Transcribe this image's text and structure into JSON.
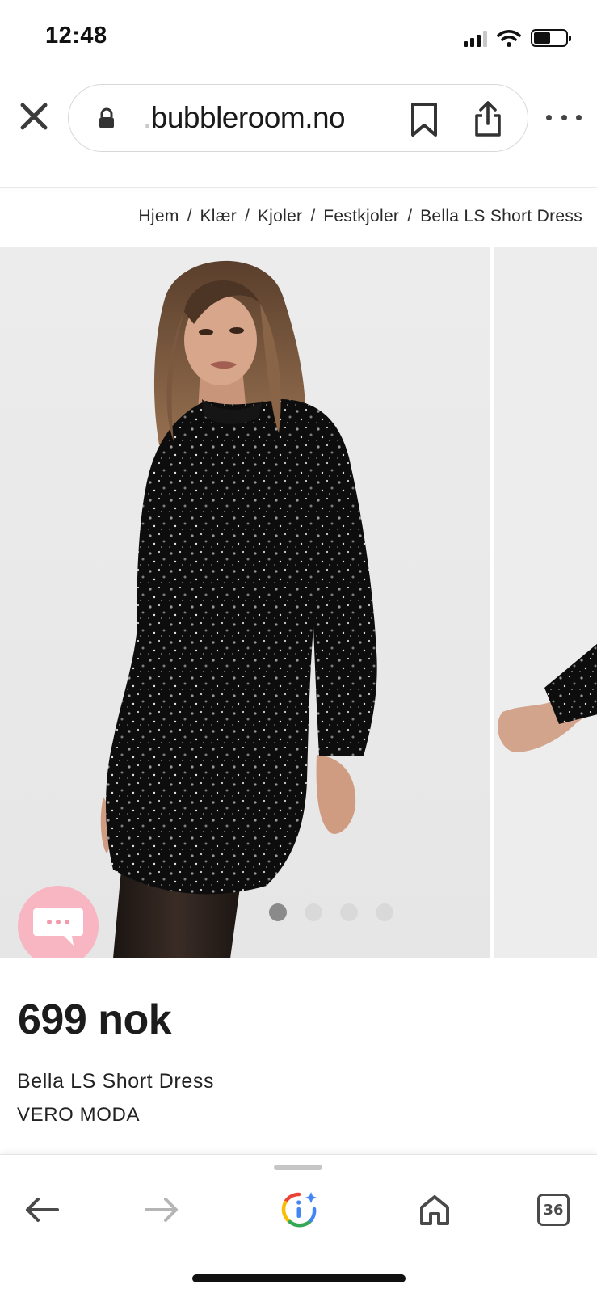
{
  "status_bar": {
    "time": "12:48",
    "icons": [
      "signal-icon",
      "wifi-icon",
      "battery-icon"
    ]
  },
  "browser": {
    "url_prefix": ".",
    "url_domain": "bubbleroom.no",
    "icons": [
      "close-icon",
      "lock-icon",
      "bookmark-icon",
      "share-icon",
      "more-icon"
    ]
  },
  "breadcrumb": {
    "items": [
      "Hjem",
      "Klær",
      "Kjoler",
      "Festkjoler",
      "Bella LS Short Dress"
    ],
    "separator": "/"
  },
  "gallery": {
    "image_count": 4,
    "active_index": 0,
    "icons": [
      "chat-icon",
      "next-arrow-icon"
    ]
  },
  "product": {
    "price": "699 nok",
    "name": "Bella LS Short Dress",
    "brand": "VERO MODA"
  },
  "toolbar": {
    "tabs_count": "36",
    "icons": [
      "back-arrow-icon",
      "forward-arrow-icon",
      "google-lens-icon",
      "home-icon",
      "tabs-icon"
    ]
  },
  "colors": {
    "chat_button": "#f7b6c1",
    "dot_active": "#8a8a8a",
    "dot_inactive": "#d9d9d9",
    "image_background": "#e9e9e9",
    "text_primary": "#1e1e1e"
  }
}
